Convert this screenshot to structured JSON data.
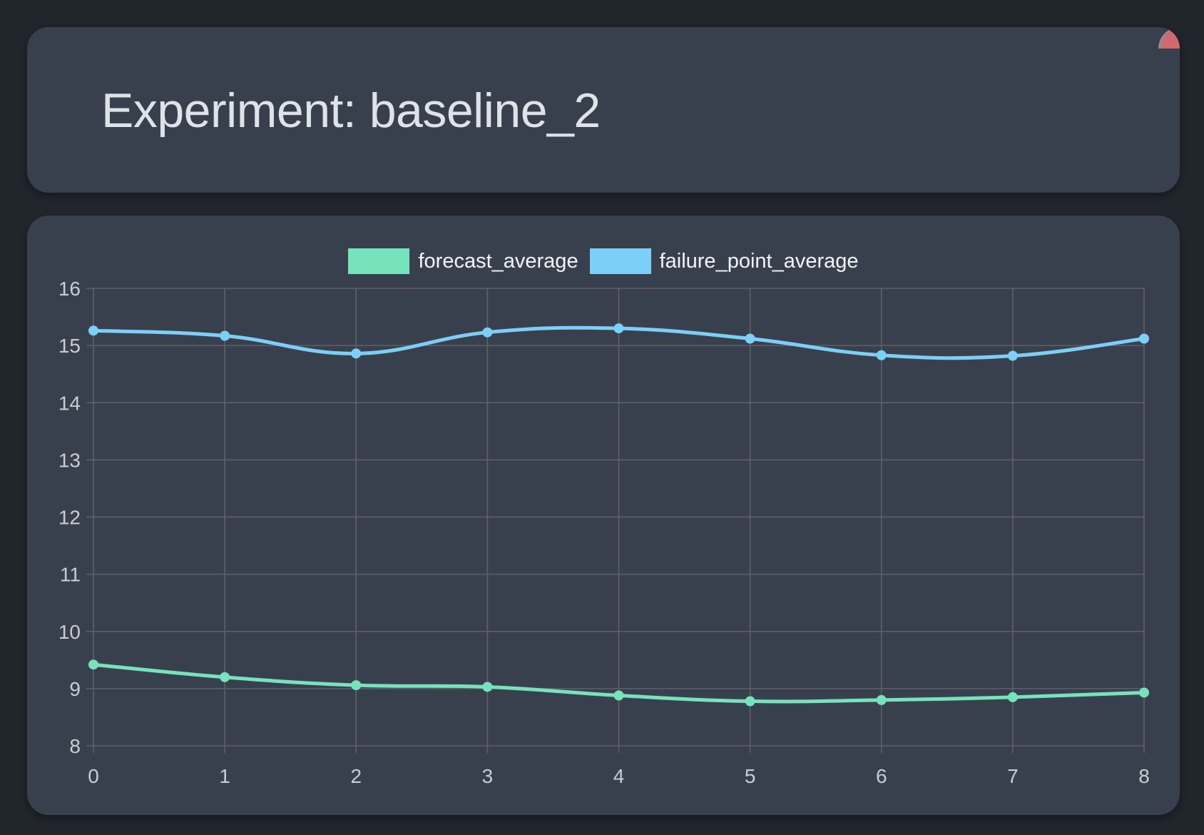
{
  "header": {
    "title": "Experiment: baseline_2"
  },
  "chart_data": {
    "type": "line",
    "x": [
      0,
      1,
      2,
      3,
      4,
      5,
      6,
      7,
      8
    ],
    "xticks": [
      "0",
      "1",
      "2",
      "3",
      "4",
      "5",
      "6",
      "7",
      "8"
    ],
    "yticks": [
      "8",
      "9",
      "10",
      "11",
      "12",
      "13",
      "14",
      "15",
      "16"
    ],
    "ylim": [
      8,
      16
    ],
    "xlim": [
      0,
      8
    ],
    "grid": true,
    "legend_position": "top-center",
    "series": [
      {
        "name": "forecast_average",
        "color": "#76e3bd",
        "values": [
          9.42,
          9.2,
          9.06,
          9.03,
          8.88,
          8.78,
          8.8,
          8.85,
          8.93
        ]
      },
      {
        "name": "failure_point_average",
        "color": "#7ccff7",
        "values": [
          15.26,
          15.17,
          14.86,
          15.23,
          15.3,
          15.12,
          14.83,
          14.82,
          15.12
        ]
      }
    ]
  },
  "colors": {
    "background": "#21252c",
    "card": "#39404d",
    "grid": "#5f6166",
    "badge": "#d06a70"
  }
}
